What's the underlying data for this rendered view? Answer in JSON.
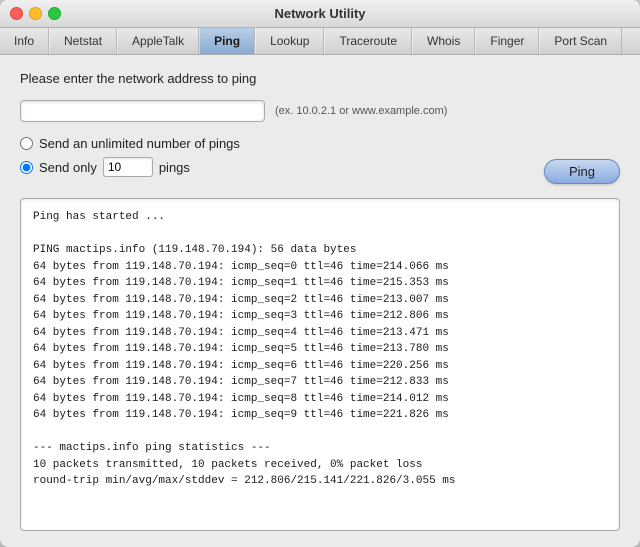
{
  "window": {
    "title": "Network Utility"
  },
  "tabs": [
    {
      "label": "Info",
      "active": false
    },
    {
      "label": "Netstat",
      "active": false
    },
    {
      "label": "AppleTalk",
      "active": false
    },
    {
      "label": "Ping",
      "active": true
    },
    {
      "label": "Lookup",
      "active": false
    },
    {
      "label": "Traceroute",
      "active": false
    },
    {
      "label": "Whois",
      "active": false
    },
    {
      "label": "Finger",
      "active": false
    },
    {
      "label": "Port Scan",
      "active": false
    }
  ],
  "ping": {
    "prompt_label": "Please enter the network address to ping",
    "address_placeholder": "",
    "address_hint": "(ex. 10.0.2.1 or www.example.com)",
    "option_unlimited": "Send an unlimited number of pings",
    "option_send_only_prefix": "Send only",
    "option_send_only_value": "10",
    "option_send_only_suffix": "pings",
    "button_label": "Ping",
    "output": "Ping has started ...\n\nPING mactips.info (119.148.70.194): 56 data bytes\n64 bytes from 119.148.70.194: icmp_seq=0 ttl=46 time=214.066 ms\n64 bytes from 119.148.70.194: icmp_seq=1 ttl=46 time=215.353 ms\n64 bytes from 119.148.70.194: icmp_seq=2 ttl=46 time=213.007 ms\n64 bytes from 119.148.70.194: icmp_seq=3 ttl=46 time=212.806 ms\n64 bytes from 119.148.70.194: icmp_seq=4 ttl=46 time=213.471 ms\n64 bytes from 119.148.70.194: icmp_seq=5 ttl=46 time=213.780 ms\n64 bytes from 119.148.70.194: icmp_seq=6 ttl=46 time=220.256 ms\n64 bytes from 119.148.70.194: icmp_seq=7 ttl=46 time=212.833 ms\n64 bytes from 119.148.70.194: icmp_seq=8 ttl=46 time=214.012 ms\n64 bytes from 119.148.70.194: icmp_seq=9 ttl=46 time=221.826 ms\n\n--- mactips.info ping statistics ---\n10 packets transmitted, 10 packets received, 0% packet loss\nround-trip min/avg/max/stddev = 212.806/215.141/221.826/3.055 ms"
  }
}
